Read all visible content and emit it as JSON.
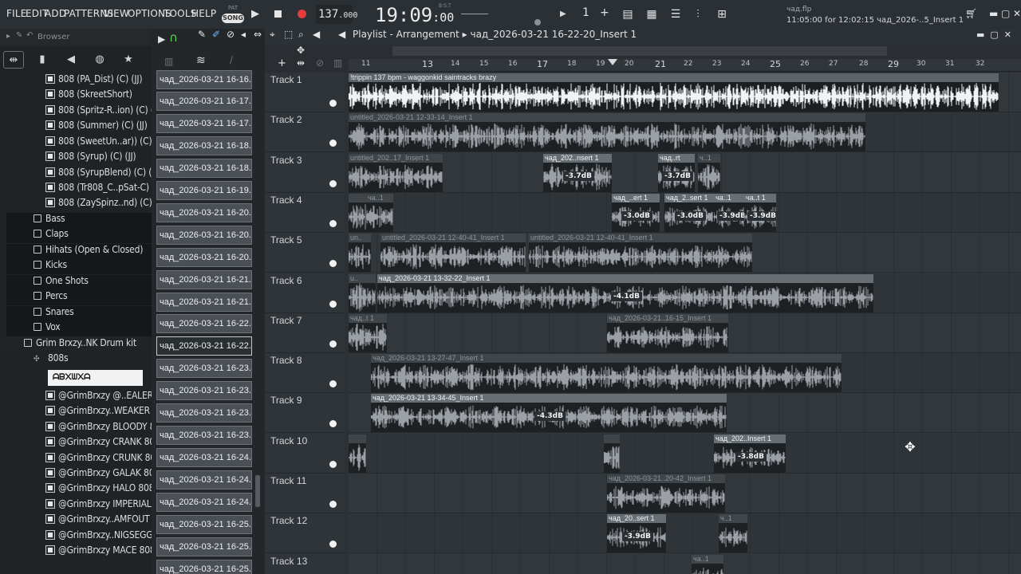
{
  "menu": [
    "FILE",
    "EDIT",
    "ADD",
    "PATTERNS",
    "VIEW",
    "OPTIONS",
    "TOOLS",
    "HELP"
  ],
  "transport": {
    "pat_label": "PAT",
    "song_label": "SONG",
    "play_icon": "play-icon",
    "stop_icon": "stop-icon",
    "record_icon": "record-icon",
    "tempo": "137",
    "tempo_fraction": ".000",
    "time_main": "19:09",
    "time_sec": ":00",
    "time_mode": "B:S:T",
    "pattern_number": "1",
    "pattern_plus": "+"
  },
  "hint": {
    "line1": "чад.flp",
    "line2": "11:05:00 for 12:02:15 чад_2026-..5_Insert 1"
  },
  "window_icons": [
    "cart-icon",
    "minimize-icon",
    "maximize-icon",
    "close-icon"
  ],
  "browser": {
    "title": "Browser",
    "tabs": [
      "all-icon",
      "file-icon",
      "speaker-icon",
      "globe-icon",
      "star-icon"
    ],
    "items": [
      {
        "label": "808 (PA_Dist) (C) (JJ)",
        "kind": "file",
        "indent": 60
      },
      {
        "label": "808 (SkreetShort)",
        "kind": "file",
        "indent": 60
      },
      {
        "label": "808 (Spritz-R..ion) (C) (JJ)",
        "kind": "file",
        "indent": 60
      },
      {
        "label": "808 (Summer) (C) (JJ)",
        "kind": "file",
        "indent": 60
      },
      {
        "label": "808 (SweetUn..ar)) (C) (JJ)",
        "kind": "file",
        "indent": 60
      },
      {
        "label": "808 (Syrup) (C) (JJ)",
        "kind": "file",
        "indent": 60
      },
      {
        "label": "808 (SyrupBlend) (C) (JJ)",
        "kind": "file",
        "indent": 60
      },
      {
        "label": "808 (Tr808_C..pSat-C) (JJ)",
        "kind": "file",
        "indent": 60
      },
      {
        "label": "808 (ZaySpinz..nd) (C) (JJ)",
        "kind": "file",
        "indent": 60
      },
      {
        "label": "Bass",
        "kind": "folder",
        "indent": 44
      },
      {
        "label": "Claps",
        "kind": "folder",
        "indent": 44
      },
      {
        "label": "Hihats (Open & Closed)",
        "kind": "folder",
        "indent": 44
      },
      {
        "label": "Kicks",
        "kind": "folder",
        "indent": 44
      },
      {
        "label": "One Shots",
        "kind": "folder",
        "indent": 44
      },
      {
        "label": "Percs",
        "kind": "folder",
        "indent": 44
      },
      {
        "label": "Snares",
        "kind": "folder",
        "indent": 44
      },
      {
        "label": "Vox",
        "kind": "folder",
        "indent": 44
      },
      {
        "label": "Grim Brxzy..NK Drum kit",
        "kind": "folder",
        "indent": 32
      },
      {
        "label": "808s",
        "kind": "subfolder",
        "indent": 44
      },
      {
        "label": "",
        "kind": "strip",
        "indent": 60
      },
      {
        "label": "@GrimBrxzy @..EALER 808",
        "kind": "file",
        "indent": 60
      },
      {
        "label": "@GrimBrxzy..WEAKER 808",
        "kind": "file",
        "indent": 60
      },
      {
        "label": "@GrimBrxzy BLOODY 808",
        "kind": "file",
        "indent": 60
      },
      {
        "label": "@GrimBrxzy CRANK 808",
        "kind": "file",
        "indent": 60
      },
      {
        "label": "@GrimBrxzy CRUNK 808",
        "kind": "file",
        "indent": 60
      },
      {
        "label": "@GrimBrxzy GALAK 808",
        "kind": "file",
        "indent": 60
      },
      {
        "label": "@GrimBrxzy HALO 808",
        "kind": "file",
        "indent": 60
      },
      {
        "label": "@GrimBrxzy IMPERIAL 808",
        "kind": "file",
        "indent": 60
      },
      {
        "label": "@GrimBrxzy..AMFOUT 808",
        "kind": "file",
        "indent": 60
      },
      {
        "label": "@GrimBrxzy..NIGSEGG 808",
        "kind": "file",
        "indent": 60
      },
      {
        "label": "@GrimBrxzy MACE 808",
        "kind": "file",
        "indent": 60
      }
    ],
    "strip_text": "ᗩᗷ᙭ᗯ᙭ᗩ"
  },
  "picker": {
    "clips": [
      "чад_2026-03-21 16-16...",
      "чад_2026-03-21 16-17...",
      "чад_2026-03-21 16-17...",
      "чад_2026-03-21 16-18...",
      "чад_2026-03-21 16-18...",
      "чад_2026-03-21 16-19...",
      "чад_2026-03-21 16-20...",
      "чад_2026-03-21 16-20...",
      "чад_2026-03-21 16-20...",
      "чад_2026-03-21 16-21...",
      "чад_2026-03-21 16-21...",
      "чад_2026-03-21 16-22...",
      "чад_2026-03-21 16-22...",
      "чад_2026-03-21 16-23...",
      "чад_2026-03-21 16-23...",
      "чад_2026-03-21 16-23...",
      "чад_2026-03-21 16-23...",
      "чад_2026-03-21 16-24...",
      "чад_2026-03-21 16-24...",
      "чад_2026-03-21 16-24...",
      "чад_2026-03-21 16-25...",
      "чад_2026-03-21 16-25...",
      "чад_2026-03-21 16-25..."
    ],
    "selected_index": 12
  },
  "playlist": {
    "title": "Playlist - Arrangement",
    "breadcrumb": "чад_2026-03-21 16-22-20_Insert 1",
    "ruler": [
      "11",
      "13",
      "14",
      "15",
      "16",
      "17",
      "18",
      "19",
      "20",
      "21",
      "22",
      "23",
      "24",
      "25",
      "26",
      "27",
      "28",
      "29",
      "30",
      "31",
      "32"
    ],
    "ruler_big": [
      "13",
      "17",
      "21",
      "25",
      "29"
    ],
    "tracks": [
      "Track 1",
      "Track 2",
      "Track 3",
      "Track 4",
      "Track 5",
      "Track 6",
      "Track 7",
      "Track 8",
      "Track 9",
      "Track 10",
      "Track 11",
      "Track 12",
      "Track 13"
    ],
    "clips": [
      {
        "track": 0,
        "title": "!trippin 137 bpm - waggonkid saintracks brazy",
        "db": ""
      },
      {
        "track": 1,
        "title": "untitled_2026-03-21 12-33-14_Insert 1",
        "db": ""
      },
      {
        "track": 2,
        "title": "untitled_202..17_Insert 1",
        "db": ""
      },
      {
        "track": 2,
        "title": "чад_202..nsert 1",
        "db": "-3.7dB"
      },
      {
        "track": 2,
        "title": "чад..rt",
        "db": "-3.7dB"
      },
      {
        "track": 2,
        "title": "ч..1",
        "db": ""
      },
      {
        "track": 3,
        "title": "",
        "db": ""
      },
      {
        "track": 3,
        "title": "ча..1",
        "db": ""
      },
      {
        "track": 3,
        "title": "чад_..ert 1",
        "db": "-3.0dB"
      },
      {
        "track": 3,
        "title": "чад_2..sert 1",
        "db": "-3.0dB"
      },
      {
        "track": 3,
        "title": "ча..1",
        "db": "-3.9dB"
      },
      {
        "track": 3,
        "title": "ча..t 1",
        "db": "-3.9dB"
      },
      {
        "track": 4,
        "title": "un..",
        "db": ""
      },
      {
        "track": 4,
        "title": "untitled_2026-03-21 12-40-41_Insert 1",
        "db": ""
      },
      {
        "track": 4,
        "title": "untitled_2026-03-21 12-40-41_Insert 1",
        "db": ""
      },
      {
        "track": 5,
        "title": "u..",
        "db": ""
      },
      {
        "track": 5,
        "title": "чад_2026-03-21 13-32-22_Insert 1",
        "db": "-4.1dB"
      },
      {
        "track": 6,
        "title": "чад..t 1",
        "db": ""
      },
      {
        "track": 6,
        "title": "чад_2026-03-21..16-15_Insert 1",
        "db": ""
      },
      {
        "track": 7,
        "title": "чад_2026-03-21 13-27-47_Insert 1",
        "db": ""
      },
      {
        "track": 8,
        "title": "чад_2026-03-21 13-34-45_Insert 1",
        "db": "-4.3dB"
      },
      {
        "track": 9,
        "title": "",
        "db": ""
      },
      {
        "track": 9,
        "title": "",
        "db": ""
      },
      {
        "track": 9,
        "title": "чад_202..Insert 1",
        "db": "-3.8dB"
      },
      {
        "track": 10,
        "title": "чад_2026-03-21..20-42_Insert 1",
        "db": ""
      },
      {
        "track": 11,
        "title": "чад_20..sert 1",
        "db": "-3.9dB"
      },
      {
        "track": 11,
        "title": "ч..1",
        "db": ""
      },
      {
        "track": 12,
        "title": "ча..1",
        "db": ""
      }
    ]
  }
}
